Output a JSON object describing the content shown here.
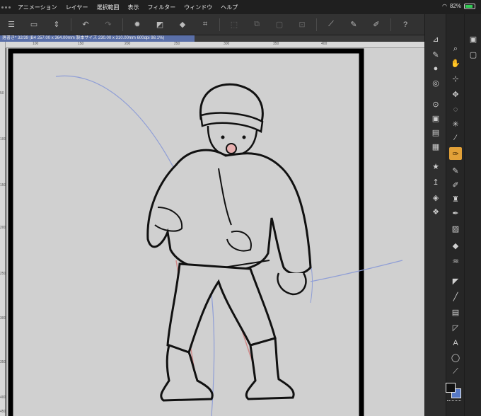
{
  "menubar": {
    "items": [
      "アニメーション",
      "レイヤー",
      "選択範囲",
      "表示",
      "フィルター",
      "ウィンドウ",
      "ヘルプ"
    ],
    "battery_percent": "82%",
    "battery_level": 0.82
  },
  "document": {
    "tab_label": "落書き* 32/39 (B4 257.00 x 364.00mm 製本サイズ 230.00 x 310.00mm 600dpi 98.1%)"
  },
  "ruler": {
    "top_ticks": [
      "100",
      "150",
      "200",
      "250",
      "300",
      "350",
      "400"
    ],
    "left_ticks": [
      "50",
      "100",
      "150",
      "200",
      "250",
      "300",
      "350",
      "400",
      "450"
    ]
  },
  "tools": {
    "active": "pen"
  },
  "colors": {
    "accent": "#e2a138",
    "tab": "#5a6fa8",
    "main_color": "#111111",
    "sub_color": "#5779c6"
  },
  "icons": {
    "toolbar": [
      "hamburger",
      "paper",
      "scroll-arrows",
      "undo",
      "redo",
      "loading",
      "clear",
      "transform",
      "crop",
      "grid",
      "select-off",
      "invert",
      "pen-fill",
      "brush",
      "line-fill",
      "help"
    ]
  }
}
